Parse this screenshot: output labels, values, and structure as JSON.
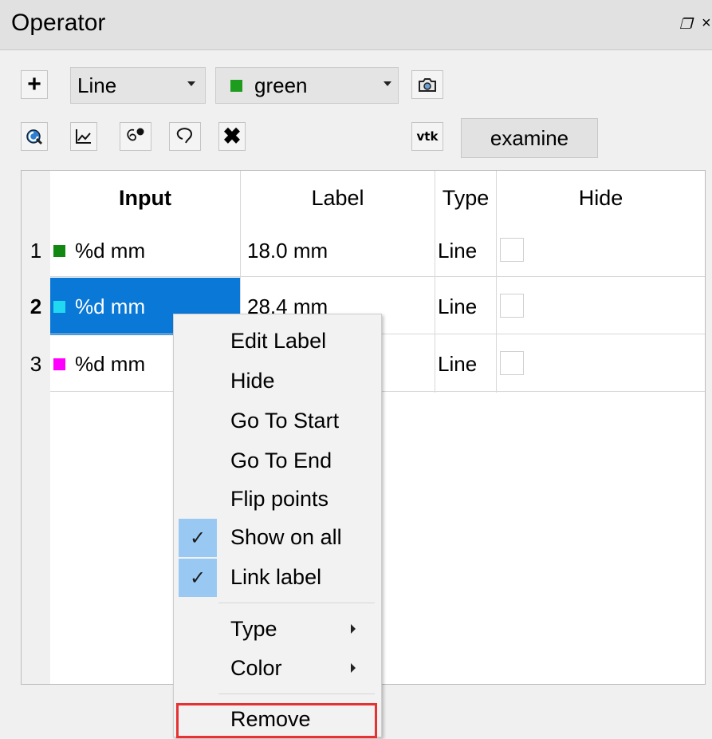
{
  "panel": {
    "title": "Operator"
  },
  "toolbar": {
    "type_combo": "Line",
    "color_combo": "green",
    "color_hex": "#1e9c1e",
    "vtk_label": "vtk",
    "examine_label": "examine"
  },
  "table": {
    "headers": [
      "Input",
      "Label",
      "Type",
      "Hide"
    ],
    "rows": [
      {
        "num": "1",
        "input": "%d mm",
        "color": "#118811",
        "label": "18.0 mm",
        "type": "Line"
      },
      {
        "num": "2",
        "input": "%d mm",
        "color": "#20d8f0",
        "label": "28.4 mm",
        "type": "Line"
      },
      {
        "num": "3",
        "input": "%d mm",
        "color": "#ff00ff",
        "label": "",
        "type": "Line"
      }
    ]
  },
  "context_menu": {
    "items": [
      "Edit Label",
      "Hide",
      "Go To Start",
      "Go To End",
      "Flip points",
      "Show on all",
      "Link label",
      "Type",
      "Color",
      "Remove"
    ],
    "check_mark": "✓"
  }
}
